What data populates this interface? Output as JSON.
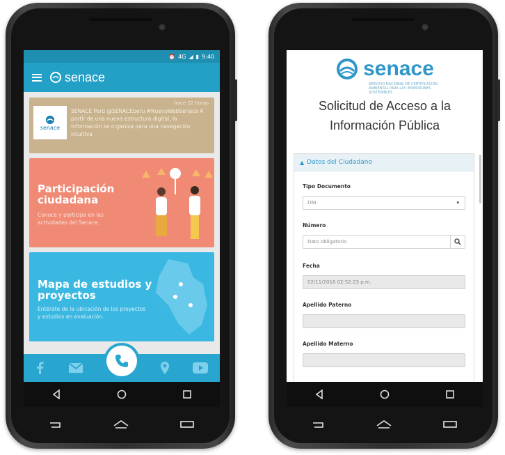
{
  "phone1": {
    "status": {
      "network": "4G",
      "time": "9:40"
    },
    "app": {
      "brand": "senace"
    },
    "tweet": {
      "logo_text": "senace",
      "time": "hace 22 horas",
      "text": "SENACE Perú @SENACEperu #NuevoWebSenace A partir de una nueva estructura digital, la información se organiza para una navegación intuitiva"
    },
    "cards": [
      {
        "title": "Participación ciudadana",
        "text": "Conoce y participa en las actividades del Senace.",
        "color": "#f08a74"
      },
      {
        "title": "Mapa de estudios y proyectos",
        "text": "Entérate de la ubicación de los proyectos y estudios en evaluación.",
        "color": "#3ab8e2"
      }
    ],
    "bottom_icons": [
      "facebook-icon",
      "mail-icon",
      "phone-icon",
      "location-icon",
      "youtube-icon"
    ]
  },
  "phone2": {
    "brand": "senace",
    "tagline": "SERVICIO NACIONAL DE CERTIFICACIÓN AMBIENTAL PARA LAS INVERSIONES SOSTENIBLES",
    "title": "Solicitud de Acceso a la Información Pública",
    "panel_title": "Datos del Ciudadano",
    "fields": {
      "tipo_documento_label": "Tipo Documento",
      "tipo_documento_value": "DNI",
      "numero_label": "Número",
      "numero_placeholder": "Dato obligatorio",
      "fecha_label": "Fecha",
      "fecha_value": "02/11/2016 02:52:23 p.m.",
      "apellido_paterno_label": "Apellido Paterno",
      "apellido_materno_label": "Apellido Materno"
    }
  },
  "colors": {
    "primary": "#22a0c5",
    "tweet": "#c9b28e",
    "orange": "#f08a74",
    "blue": "#3ab8e2",
    "link": "#2f96c9"
  }
}
